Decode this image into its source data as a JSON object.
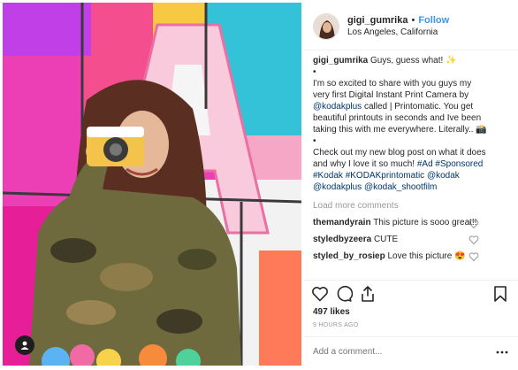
{
  "header": {
    "username": "gigi_gumrika",
    "separator": "•",
    "follow_label": "Follow",
    "location": "Los Angeles, California"
  },
  "caption": {
    "username": "gigi_gumrika",
    "line1": "Guys, guess what! ✨",
    "bullet1": "•",
    "para1_a": "I'm so excited to share with you guys my very first Digital Instant Print Camera by ",
    "para1_mention": "@kodakplus",
    "para1_b": " called | Printomatic. You get beautiful printouts in seconds and Ive been taking this with me everywhere. Literally.. 📸",
    "bullet2": "•",
    "para2_a": "Check out my new blog post on what it does and why I love it so much! ",
    "para2_tags": "#Ad #Sponsored #Kodak #KODAKprintomatic @kodak @kodakplus @kodak_shootfilm"
  },
  "load_more_label": "Load more comments",
  "comments": [
    {
      "user": "themandyrain",
      "text": "This picture is sooo great!!"
    },
    {
      "user": "styledbyzeera",
      "text": "CUTE"
    },
    {
      "user": "styled_by_rosiep",
      "text": "Love this picture 😍"
    }
  ],
  "likes_text": "497 likes",
  "timestamp": "9 HOURS AGO",
  "add_comment_placeholder": "Add a comment...",
  "icons": {
    "like": "heart-icon",
    "comment": "comment-bubble-icon",
    "share": "share-icon",
    "save": "bookmark-icon",
    "more": "more-dots-icon",
    "user_tag": "person-icon"
  },
  "colors": {
    "follow": "#3897f0",
    "link": "#003569",
    "muted": "#999999"
  }
}
